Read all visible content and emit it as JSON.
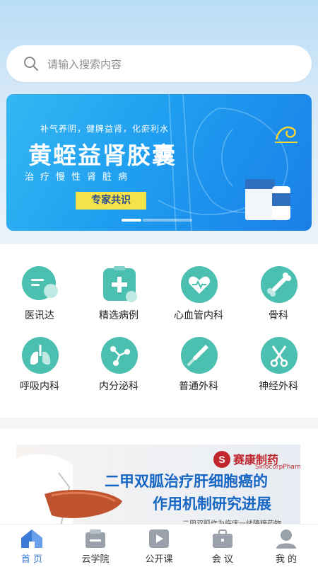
{
  "search": {
    "placeholder": "请输入搜索内容"
  },
  "banner": {
    "tagline": "补气养阴，健脾益肾，化瘀利水",
    "product": "黄蛭益肾胶囊",
    "subtitle": "治疗慢性肾脏病",
    "button": "专家共识",
    "slides": 2,
    "active_slide": 1
  },
  "categories": [
    {
      "label": "医讯达",
      "icon": "chat-bubble-icon"
    },
    {
      "label": "精选病例",
      "icon": "medical-clipboard-icon"
    },
    {
      "label": "心血管内科",
      "icon": "heart-pulse-icon"
    },
    {
      "label": "骨科",
      "icon": "bone-icon"
    },
    {
      "label": "呼吸内科",
      "icon": "lungs-icon"
    },
    {
      "label": "内分泌科",
      "icon": "molecule-icon"
    },
    {
      "label": "普通外科",
      "icon": "scalpel-icon"
    },
    {
      "label": "神经外科",
      "icon": "scissors-icon"
    }
  ],
  "article": {
    "brand": "赛康制药",
    "brand_en": "SinocorpPharma",
    "title_line1": "二甲双胍治疗肝细胞癌的",
    "title_line2": "作用机制研究进展",
    "caption": "二甲双胍作为临床一线降糖药物"
  },
  "tabs": [
    {
      "label": "首 页",
      "icon": "home-icon",
      "active": true
    },
    {
      "label": "云学院",
      "icon": "academy-icon",
      "active": false
    },
    {
      "label": "公开课",
      "icon": "play-icon",
      "active": false
    },
    {
      "label": "会 议",
      "icon": "briefcase-icon",
      "active": false
    },
    {
      "label": "我 的",
      "icon": "user-icon",
      "active": false
    }
  ],
  "colors": {
    "accent": "#3b7bd8",
    "icon_teal": "#4bbfb0",
    "banner_yellow": "#f5e34a"
  }
}
